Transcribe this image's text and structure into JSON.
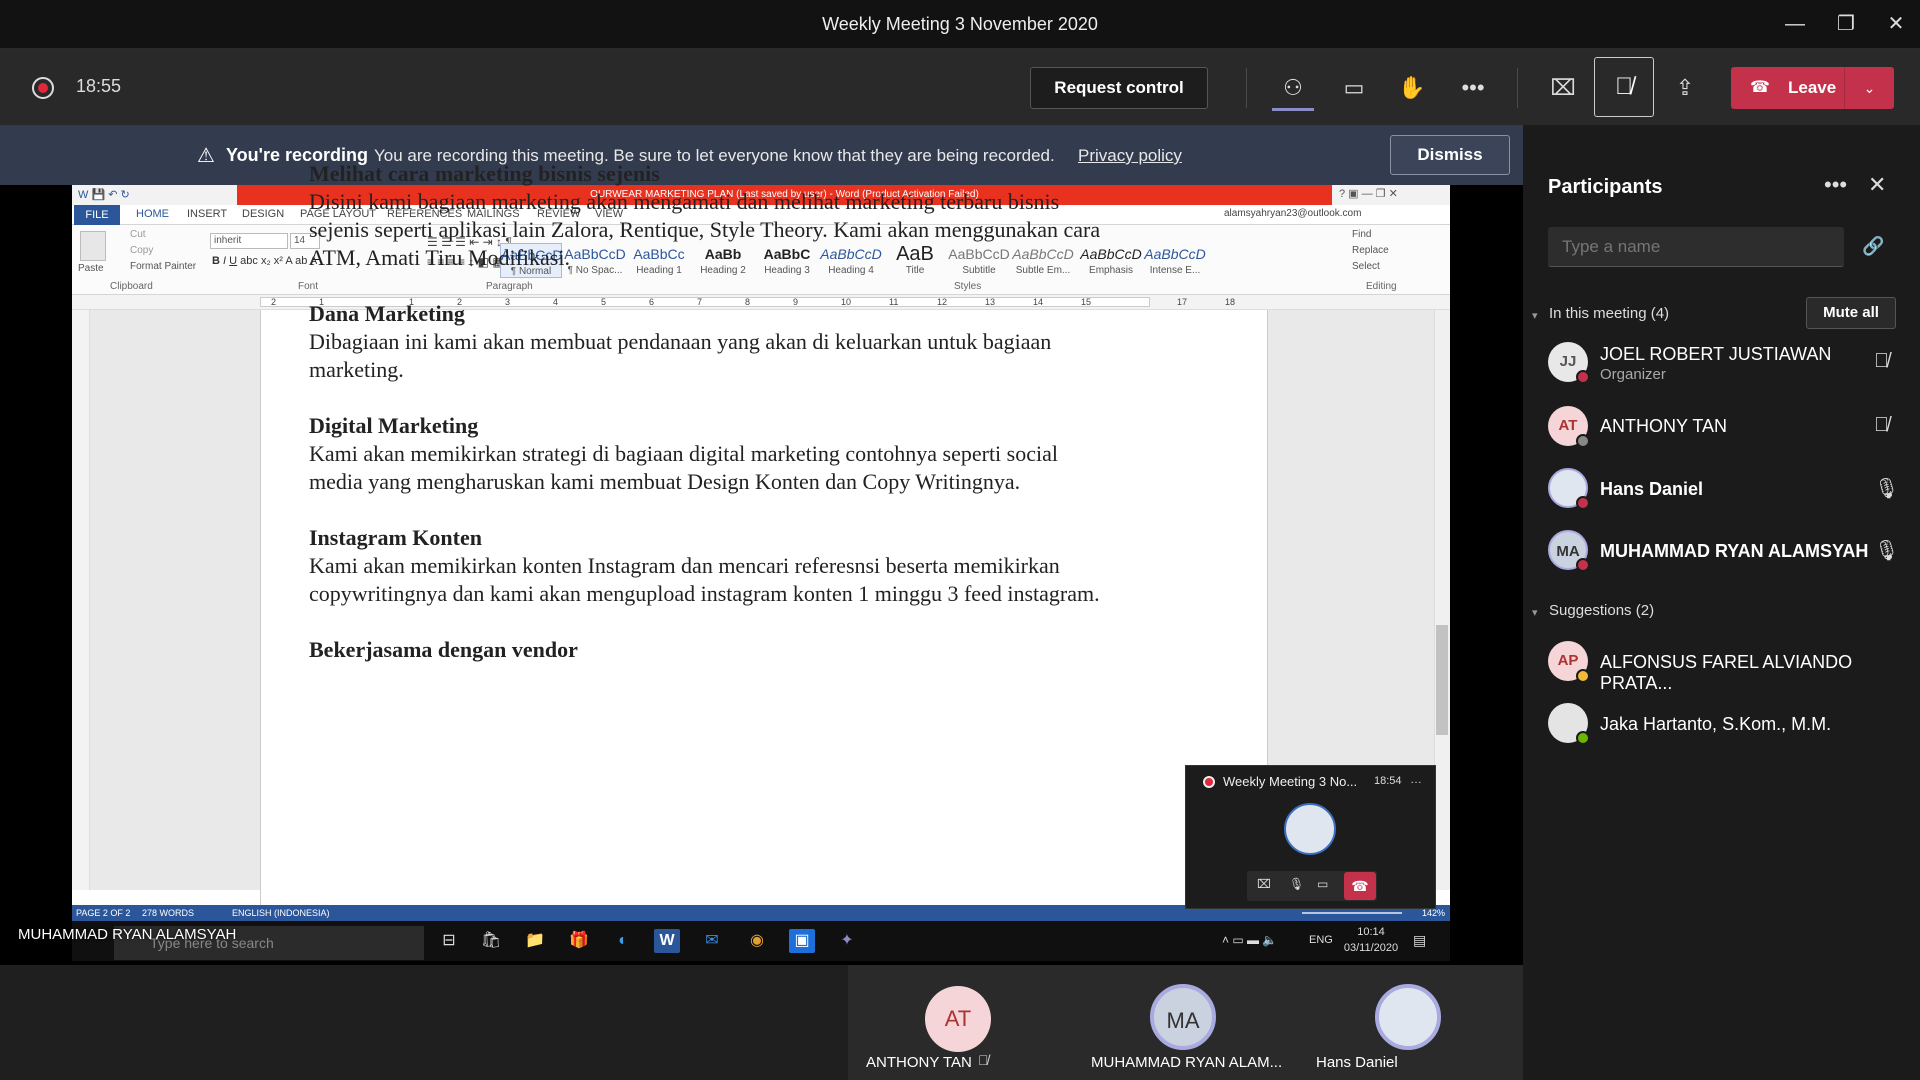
{
  "window": {
    "title": "Weekly Meeting 3 November 2020"
  },
  "toolbar": {
    "timer": "18:55",
    "request_control": "Request control",
    "leave": "Leave"
  },
  "banner": {
    "bold": "You're recording",
    "text": "You are recording this meeting. Be sure to let everyone know that they are being recorded.",
    "link": "Privacy policy",
    "dismiss": "Dismiss"
  },
  "word": {
    "title": "OURWEAR MARKETING PLAN (Last saved by user) - Word (Product Activation Failed)",
    "account": "alamsyahryan23@outlook.com",
    "tabs": [
      "FILE",
      "HOME",
      "INSERT",
      "DESIGN",
      "PAGE LAYOUT",
      "REFERENCES",
      "MAILINGS",
      "REVIEW",
      "VIEW"
    ],
    "clipboard": {
      "paste": "Paste",
      "cut": "Cut",
      "copy": "Copy",
      "format_painter": "Format Painter"
    },
    "font": {
      "name": "inherit",
      "size": "14"
    },
    "groups": [
      "Clipboard",
      "Font",
      "Paragraph",
      "Styles",
      "Editing"
    ],
    "styles": [
      {
        "sample": "AaBbCcD",
        "name": "¶ Normal"
      },
      {
        "sample": "AaBbCcD",
        "name": "¶ No Spac..."
      },
      {
        "sample": "AaBbCc",
        "name": "Heading 1"
      },
      {
        "sample": "AaBb",
        "name": "Heading 2"
      },
      {
        "sample": "AaBbC",
        "name": "Heading 3"
      },
      {
        "sample": "AaBbCcD",
        "name": "Heading 4"
      },
      {
        "sample": "AaB",
        "name": "Title"
      },
      {
        "sample": "AaBbCcD",
        "name": "Subtitle"
      },
      {
        "sample": "AaBbCcD",
        "name": "Subtle Em..."
      },
      {
        "sample": "AaBbCcD",
        "name": "Emphasis"
      },
      {
        "sample": "AaBbCcD",
        "name": "Intense E..."
      }
    ],
    "editing": {
      "find": "Find",
      "replace": "Replace",
      "select": "Select"
    },
    "ruler": [
      "2",
      "1",
      "1",
      "2",
      "3",
      "4",
      "5",
      "6",
      "7",
      "8",
      "9",
      "10",
      "11",
      "12",
      "13",
      "14",
      "15",
      "17",
      "18"
    ],
    "status": {
      "page": "PAGE 2 OF 2",
      "words": "278 WORDS",
      "lang": "ENGLISH (INDONESIA)",
      "zoom": "142%"
    },
    "doc": [
      {
        "heading": "Melihat cara marketing bisnis sejenis",
        "body": "Disini kami bagiaan marketing akan mengamati dan melihat marketing terbaru bisnis sejenis seperti aplikasi lain Zalora, Rentique, Style Theory. Kami akan menggunakan cara ATM, Amati Tiru Modifikasi."
      },
      {
        "heading": "Dana Marketing",
        "body": "Dibagiaan ini kami akan membuat pendanaan yang akan di keluarkan untuk bagiaan marketing."
      },
      {
        "heading": "Digital Marketing",
        "body": "Kami akan memikirkan strategi di bagiaan digital marketing contohnya seperti social media yang mengharuskan kami membuat Design Konten dan Copy Writingnya."
      },
      {
        "heading": "Instagram Konten",
        "body": "Kami akan memikirkan konten Instagram dan mencari referesnsi beserta memikirkan copywritingnya dan kami akan mengupload instagram konten 1 minggu 3 feed instagram."
      },
      {
        "heading": "Bekerjasama dengan vendor",
        "body": ""
      }
    ]
  },
  "taskbar": {
    "search": "Type here to search",
    "lang": "ENG",
    "time": "10:14",
    "date": "03/11/2020"
  },
  "sharer_label": "MUHAMMAD RYAN ALAMSYAH",
  "mini": {
    "title": "Weekly Meeting 3 No...",
    "time": "18:54"
  },
  "panel": {
    "title": "Participants",
    "search_placeholder": "Type a name",
    "in_meeting": "In this meeting (4)",
    "mute_all": "Mute all",
    "suggestions": "Suggestions (2)",
    "participants": [
      {
        "initials": "JJ",
        "name": "JOEL ROBERT JUSTIAWAN",
        "role": "Organizer"
      },
      {
        "initials": "AT",
        "name": "ANTHONY TAN",
        "role": ""
      },
      {
        "initials": "",
        "name": "Hans Daniel",
        "role": ""
      },
      {
        "initials": "MA",
        "name": "MUHAMMAD RYAN ALAMSYAH",
        "role": ""
      }
    ],
    "suggested": [
      {
        "initials": "AP",
        "name": "ALFONSUS FAREL ALVIANDO PRATA..."
      },
      {
        "initials": "",
        "name": "Jaka Hartanto, S.Kom., M.M."
      }
    ]
  },
  "strip": [
    {
      "initials": "AT",
      "name": "ANTHONY TAN"
    },
    {
      "initials": "MA",
      "name": "MUHAMMAD RYAN ALAM..."
    },
    {
      "initials": "",
      "name": "Hans Daniel"
    }
  ],
  "colors": {
    "leave": "#c4314b",
    "banner": "#333c4f",
    "word_blue": "#2b579a",
    "word_title_red": "#e8311e",
    "record_red": "#e0283c"
  }
}
